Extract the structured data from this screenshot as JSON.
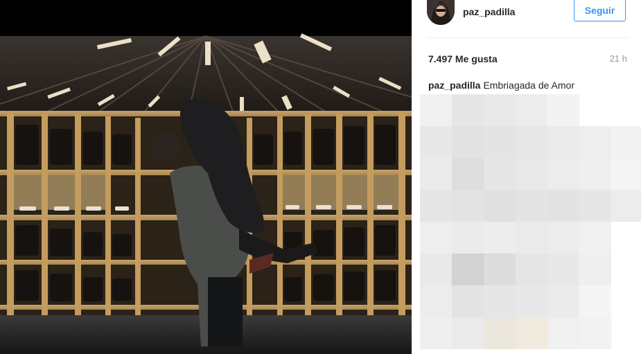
{
  "post": {
    "username": "paz_padilla",
    "follow_label": "Seguir",
    "likes": "7.497 Me gusta",
    "time_ago": "21 h",
    "caption_user": "paz_padilla",
    "caption_text": "Embriagada de Amor"
  },
  "photo": {
    "description_icon": "wine-cellar-couple-photo"
  },
  "colors": {
    "accent": "#3897f0",
    "text": "#262626",
    "muted": "#999999"
  }
}
